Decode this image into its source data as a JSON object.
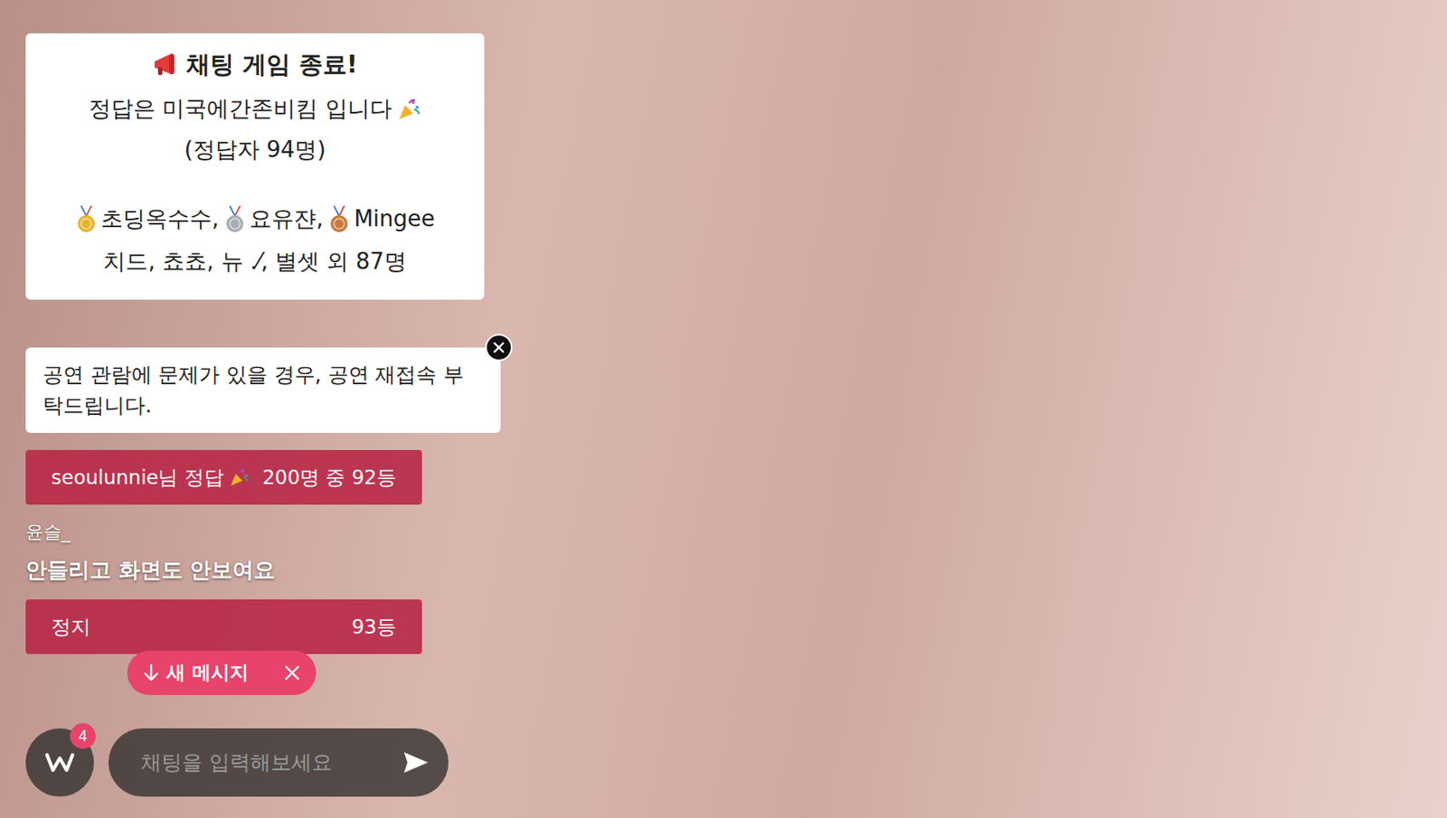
{
  "game_result": {
    "title": "채팅 게임 종료!",
    "answer": "정답은 미국에간존비킴 입니다",
    "answer_count": "(정답자 94명)",
    "medalists": [
      {
        "name": "초딩옥수수",
        "color": "#e8b42a"
      },
      {
        "name": "요유쟌",
        "color": "#a9adb3"
      },
      {
        "name": "Mingee",
        "color": "#c97a3a"
      }
    ],
    "others": "치드, 쵸쵸, 뉴 .⁄, 별셋 외 87명"
  },
  "notice": {
    "text": "공연 관람에 문제가 있을 경우, 공연 재접속 부탁드립니다."
  },
  "chat": [
    {
      "kind": "correct",
      "user": "seoulunnie님 정답",
      "rank": "200명 중 92등",
      "text": ""
    },
    {
      "kind": "message",
      "user": "윤슬_",
      "rank": "",
      "text": "안들리고 화면도 안보여요"
    },
    {
      "kind": "correct",
      "user": "정지",
      "rank": "93등",
      "text": ""
    }
  ],
  "new_message_button": {
    "label": "새 메시지"
  },
  "input": {
    "placeholder": "채팅을 입력해보세요"
  },
  "notification_badge": "4"
}
